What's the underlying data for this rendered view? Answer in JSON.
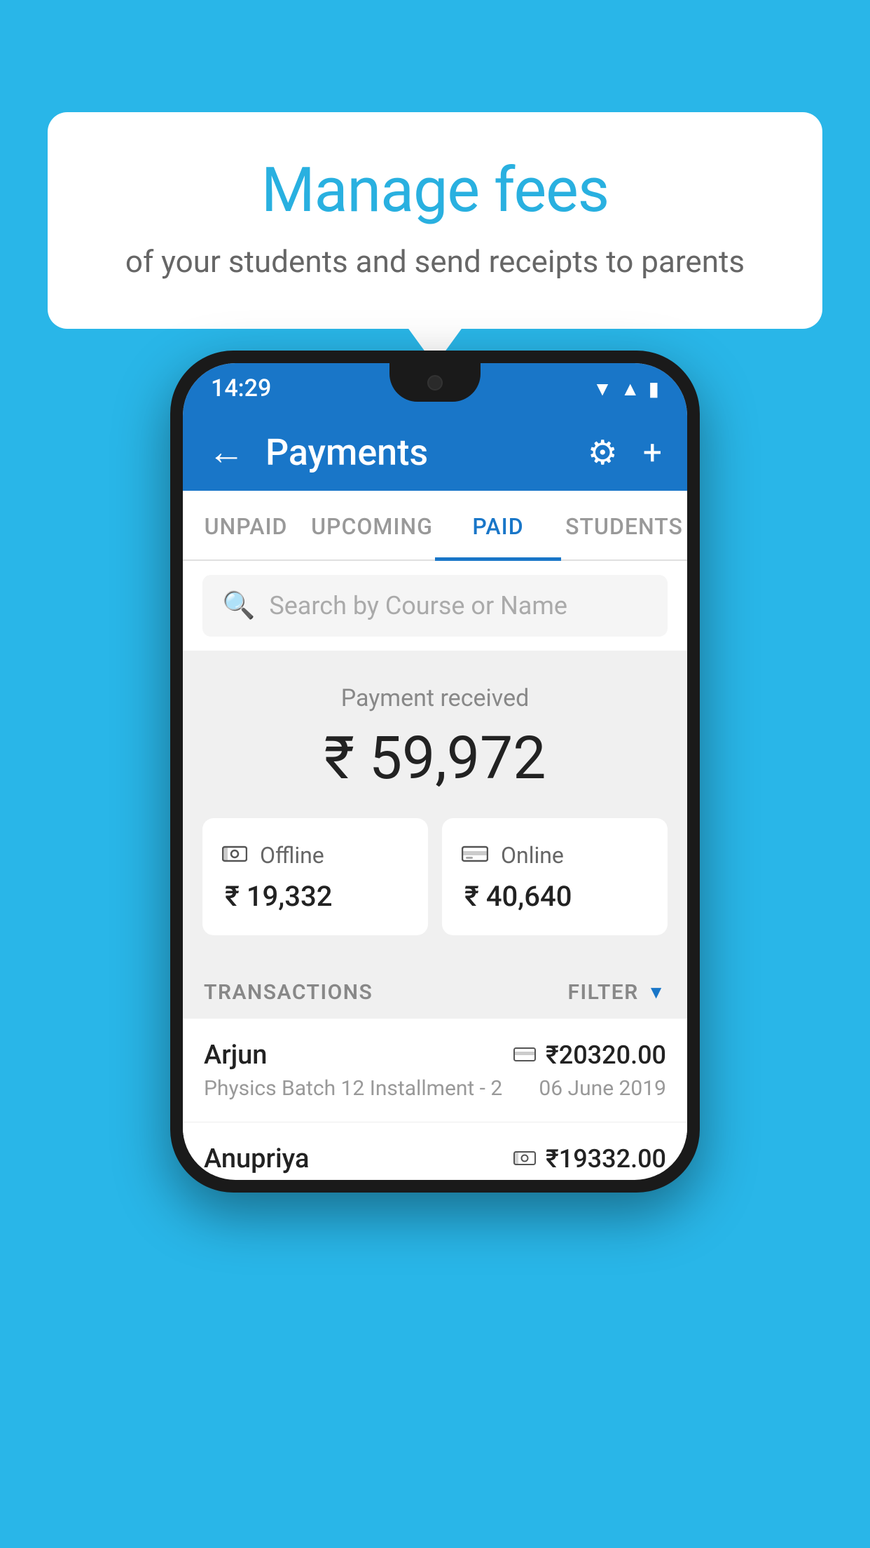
{
  "background_color": "#29b6e8",
  "bubble": {
    "title": "Manage fees",
    "subtitle": "of your students and send receipts to parents"
  },
  "phone": {
    "status_bar": {
      "time": "14:29"
    },
    "app_bar": {
      "title": "Payments",
      "back_label": "←",
      "gear_label": "⚙",
      "plus_label": "+"
    },
    "tabs": [
      {
        "label": "UNPAID",
        "active": false
      },
      {
        "label": "UPCOMING",
        "active": false
      },
      {
        "label": "PAID",
        "active": true
      },
      {
        "label": "STUDENTS",
        "active": false
      }
    ],
    "search": {
      "placeholder": "Search by Course or Name"
    },
    "payment_summary": {
      "label": "Payment received",
      "amount": "₹ 59,972",
      "offline_label": "Offline",
      "offline_amount": "₹ 19,332",
      "online_label": "Online",
      "online_amount": "₹ 40,640"
    },
    "transactions": {
      "header_label": "TRANSACTIONS",
      "filter_label": "FILTER",
      "items": [
        {
          "name": "Arjun",
          "amount": "₹20320.00",
          "course": "Physics Batch 12 Installment - 2",
          "date": "06 June 2019",
          "payment_type": "card"
        },
        {
          "name": "Anupriya",
          "amount": "₹19332.00",
          "course": "",
          "date": "",
          "payment_type": "cash"
        }
      ]
    }
  }
}
